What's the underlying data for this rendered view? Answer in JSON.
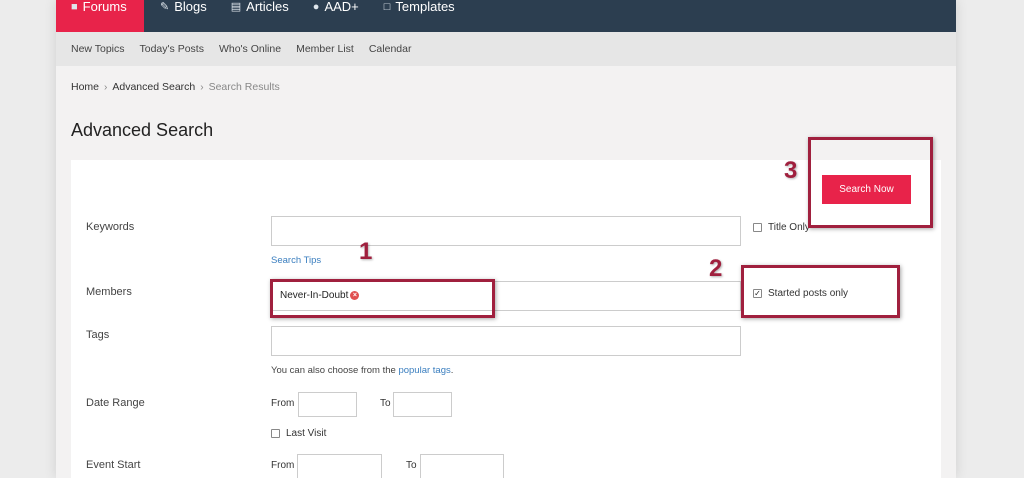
{
  "topnav": {
    "tabs": [
      {
        "label": "Forums",
        "icon": "forums-icon"
      },
      {
        "label": "Blogs",
        "icon": "pencil-icon"
      },
      {
        "label": "Articles",
        "icon": "article-icon"
      },
      {
        "label": "AAD+",
        "icon": "users-icon"
      },
      {
        "label": "Templates",
        "icon": "page-icon"
      }
    ],
    "active_color": "#e8234a",
    "bg_color": "#2c3e50"
  },
  "subnav": {
    "items": [
      "New Topics",
      "Today's Posts",
      "Who's Online",
      "Member List",
      "Calendar"
    ]
  },
  "breadcrumb": {
    "items": [
      "Home",
      "Advanced Search",
      "Search Results"
    ]
  },
  "page_title": "Advanced Search",
  "form": {
    "search_button": "Search Now",
    "keywords": {
      "label": "Keywords",
      "value": "",
      "tips_link": "Search Tips",
      "title_only": {
        "label": "Title Only",
        "checked": false
      }
    },
    "members": {
      "label": "Members",
      "chip": "Never-In-Doubt",
      "started_posts_only": {
        "label": "Started posts only",
        "checked": true
      }
    },
    "tags": {
      "label": "Tags",
      "hint_prefix": "You can also choose from the ",
      "hint_link": "popular tags",
      "hint_suffix": "."
    },
    "date_range": {
      "label": "Date Range",
      "from_label": "From",
      "to_label": "To",
      "last_visit": {
        "label": "Last Visit",
        "checked": false
      }
    },
    "event_start": {
      "label": "Event Start",
      "from_label": "From",
      "to_label": "To"
    }
  },
  "annotations": [
    "1",
    "2",
    "3"
  ],
  "annotation_color": "#a0203e"
}
